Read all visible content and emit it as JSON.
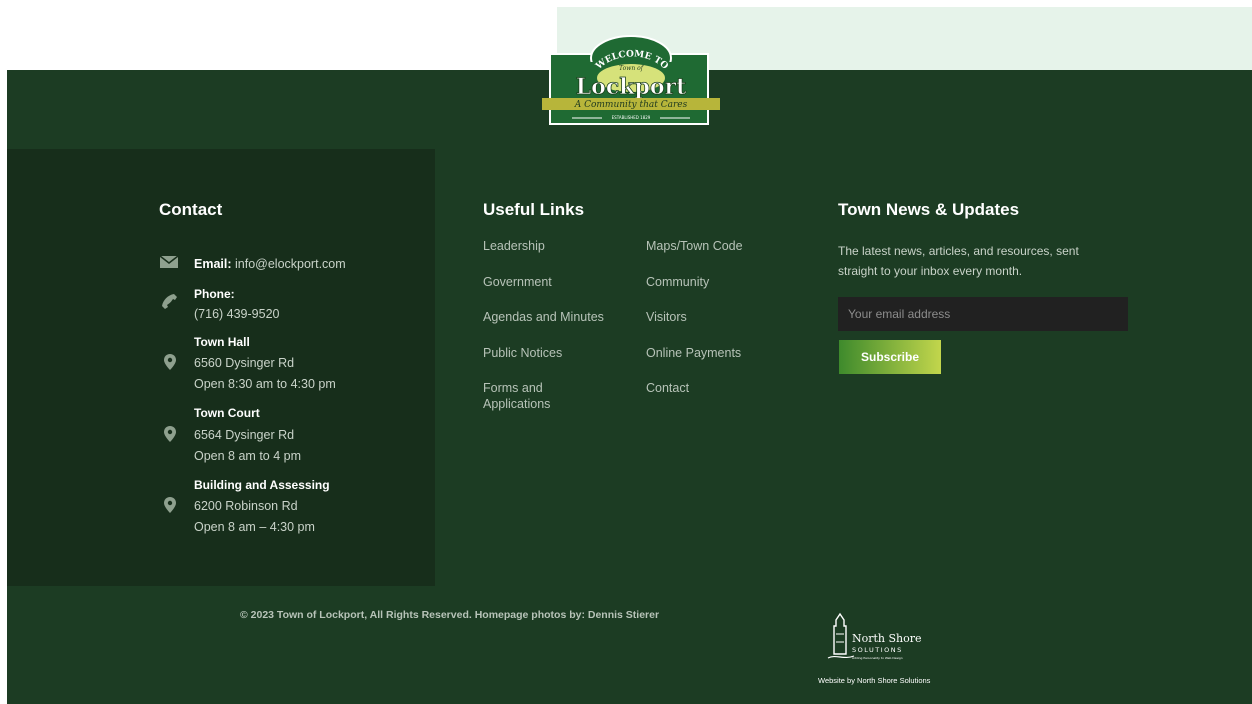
{
  "logo": {
    "top_text": "WELCOME TO",
    "small_text": "Town of",
    "name": "Lockport",
    "tagline": "A Community that Cares",
    "established": "ESTABLISHED 1829"
  },
  "contact": {
    "title": "Contact",
    "email_label": "Email:",
    "email": "info@elockport.com",
    "phone_label": "Phone:",
    "phone": "(716) 439-9520",
    "locations": [
      {
        "name": "Town Hall",
        "address": "6560 Dysinger Rd",
        "hours": "Open 8:30 am to 4:30 pm"
      },
      {
        "name": "Town Court",
        "address": "6564 Dysinger Rd",
        "hours": "Open 8 am to 4 pm"
      },
      {
        "name": "Building and Assessing",
        "address": "6200 Robinson Rd",
        "hours": "Open 8 am – 4:30 pm"
      }
    ]
  },
  "links": {
    "title": "Useful Links",
    "col1": [
      "Leadership",
      "Government",
      "Agendas and Minutes",
      "Public Notices",
      "Forms and Applications"
    ],
    "col2": [
      "Maps/Town Code",
      "Community",
      "Visitors",
      "Online Payments",
      "Contact"
    ]
  },
  "news": {
    "title": "Town News & Updates",
    "description": "The latest news, articles, and resources, sent straight to your inbox every month.",
    "email_placeholder": "Your email address",
    "subscribe_label": "Subscribe"
  },
  "footer": {
    "copyright": "© 2023 Town of Lockport, All Rights Reserved. Homepage photos by: Dennis Stierer",
    "ns_name": "North Shore",
    "ns_solutions": "SOLUTIONS",
    "ns_tag": "Adding Personality to Web Design",
    "credit": "Website by North Shore Solutions"
  },
  "colors": {
    "footer_bg": "#1c3c23",
    "contact_bg": "#172e1b",
    "top_band": "#e6f3ea",
    "subscribe_start": "#3e8a2c",
    "subscribe_end": "#c2d64c"
  }
}
